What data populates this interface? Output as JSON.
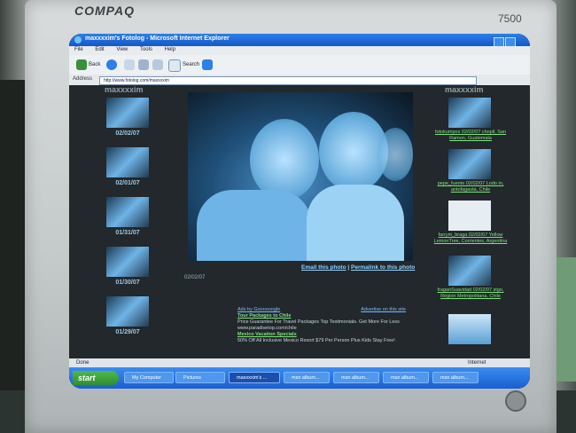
{
  "monitor": {
    "brand": "COMPAQ",
    "model": "7500"
  },
  "browser": {
    "title": "maxxxxim's Fotolog - Microsoft Internet Explorer",
    "menu": [
      "File",
      "Edit",
      "View",
      "Tools",
      "Help"
    ],
    "toolbar": {
      "back_label": "Back",
      "search_label": "Search"
    },
    "address_label": "Address",
    "address_value": "http://www.fotolog.com/maxxxxim",
    "status": "Done",
    "zone": "Internet"
  },
  "page": {
    "username_left": "maxxxxim",
    "username_right": "maxxxxim",
    "thumbnails": [
      {
        "date": "02/02/07"
      },
      {
        "date": "02/01/07"
      },
      {
        "date": "01/31/07"
      },
      {
        "date": "01/30/07"
      },
      {
        "date": "01/29/07"
      }
    ],
    "email_link": "Email this photo",
    "permalink": "Permalink to this photo",
    "separator": "|",
    "photo_date": "02/02/07",
    "ads": {
      "by": "Ads by Goooooogle",
      "advertise": "Advertise on this site",
      "items": [
        {
          "title": "Tour Packages to Chile",
          "text": "Price Guarantee For Travel Packages Top Testimonials. Get More For Less",
          "url": "www.paradisetop.com/chile"
        },
        {
          "title": "Mexico Vacation Specials",
          "text": "50% Off All Inclusive Mexico Resort $79 Per Person Plus Kids Stay Free!",
          "url": ""
        }
      ]
    },
    "right_items": [
      {
        "text": "fotokumpos 02/02/07 chopil, San Ramon, Guatemala"
      },
      {
        "text": "pepe_fuente 02/02/07 Lodo in, antofagasta, Chile"
      },
      {
        "text": "farrym_braga 02/02/07 Yellow LemonTree, Corrientes, Argentina"
      },
      {
        "text": "fraganSuavidad 02/02/07 stgo, Region Metropolitana, Chile"
      }
    ]
  },
  "taskbar": {
    "start": "start",
    "tasks": [
      "My Computer",
      "Pictures",
      "maxxxxim's ...",
      "msn album...",
      "msn album...",
      "msn album...",
      "msn album..."
    ]
  },
  "colors": {
    "xp_blue": "#2e7fe8",
    "start_green": "#3a9a3a",
    "link_green": "#7fe27f",
    "link_blue": "#8fd0ff"
  }
}
